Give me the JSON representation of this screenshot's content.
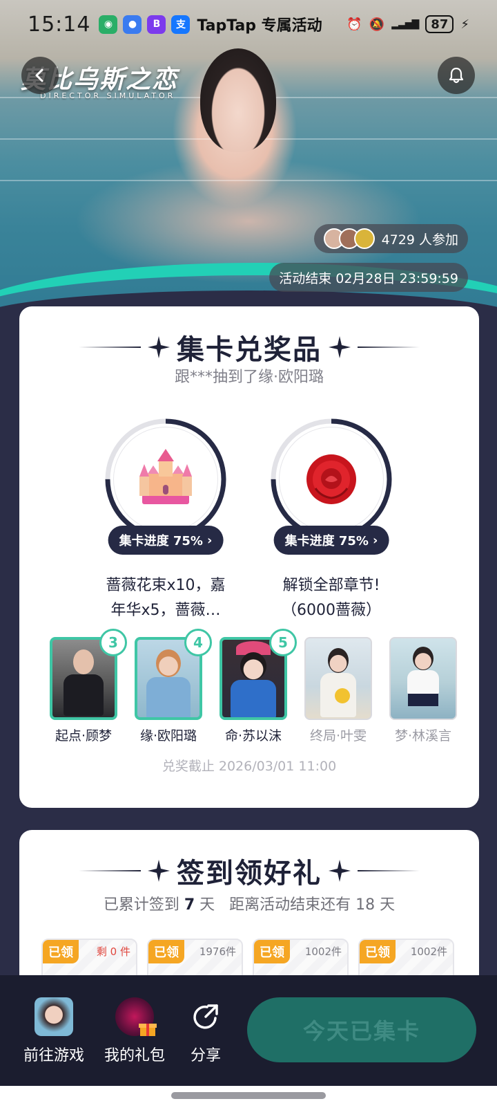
{
  "status_bar": {
    "time": "15:14",
    "title": "TapTap 专属活动",
    "battery": "87",
    "apps": [
      {
        "name": "wechat-icon",
        "color": "#2aae67",
        "glyph": "◉"
      },
      {
        "name": "message-icon",
        "color": "#3a7bf0",
        "glyph": "●"
      },
      {
        "name": "bank-icon",
        "color": "#7c3aed",
        "glyph": "B"
      },
      {
        "name": "alipay-icon",
        "color": "#1677ff",
        "glyph": "支"
      }
    ]
  },
  "hero": {
    "game_logo": "莫比乌斯之恋",
    "game_logo_sub": "DIRECTOR SIMULATOR",
    "participants": "4729 人参加",
    "end_time": "活动结束 02月28日 23:59:59"
  },
  "collect": {
    "title": "集卡兑奖品",
    "subtitle": "跟***抽到了缘·欧阳璐",
    "prizes": [
      {
        "icon": "castle-icon",
        "progress_label": "集卡进度 75%",
        "progress": 0.75,
        "desc_line1": "蔷薇花束x10，嘉",
        "desc_line2": "年华x5，蔷薇…"
      },
      {
        "icon": "rose-icon",
        "progress_label": "集卡进度 75%",
        "progress": 0.75,
        "desc_line1": "解锁全部章节!",
        "desc_line2": "（6000蔷薇）"
      }
    ],
    "cards": [
      {
        "name": "起点·顾梦",
        "count": "3",
        "collected": true
      },
      {
        "name": "缘·欧阳璐",
        "count": "4",
        "collected": true
      },
      {
        "name": "命·苏以沫",
        "count": "5",
        "collected": true
      },
      {
        "name": "终局·叶雯",
        "count": "",
        "collected": false
      },
      {
        "name": "梦·林溪言",
        "count": "",
        "collected": false
      }
    ],
    "deadline": "兑奖截止 2026/03/01 11:00"
  },
  "checkin": {
    "title": "签到领好礼",
    "days_prefix": "已累计签到",
    "days": "7",
    "days_unit": "天",
    "remaining": "距离活动结束还有 18 天",
    "gifts": [
      {
        "tag": "已领",
        "stock": "剩 0 件",
        "stock_red": true
      },
      {
        "tag": "已领",
        "stock": "1976件",
        "stock_red": false
      },
      {
        "tag": "已领",
        "stock": "1002件",
        "stock_red": false
      },
      {
        "tag": "已领",
        "stock": "1002件",
        "stock_red": false
      }
    ]
  },
  "bottom_bar": {
    "go_game": "前往游戏",
    "my_gifts": "我的礼包",
    "share": "分享",
    "main_button": "今天已集卡"
  }
}
